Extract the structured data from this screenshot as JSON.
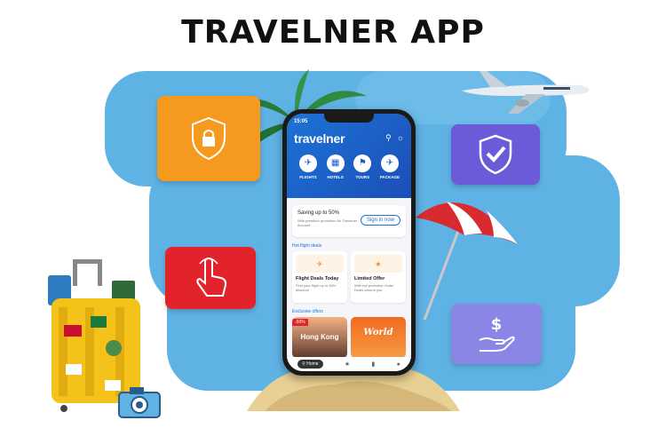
{
  "headline": "TRAVELNER APP",
  "colors": {
    "sky": "#5fb2e4",
    "security_card": "#f59a1e",
    "verified_card": "#6b5bd9",
    "tap_card": "#e3232b",
    "payment_card": "#8a86e6",
    "app_blue": "#1e73d6"
  },
  "feature_cards": [
    {
      "name": "security",
      "icon": "shield-lock-icon"
    },
    {
      "name": "verified",
      "icon": "shield-check-icon"
    },
    {
      "name": "tap",
      "icon": "hand-tap-icon"
    },
    {
      "name": "payment",
      "icon": "hand-dollar-icon"
    }
  ],
  "phone": {
    "time": "15:05",
    "brand": "travelner",
    "header_icons": [
      "search-icon",
      "chat-icon"
    ],
    "nav": [
      {
        "label": "FLIGHTS",
        "icon": "plane-icon"
      },
      {
        "label": "HOTELS",
        "icon": "building-icon"
      },
      {
        "label": "TOURS",
        "icon": "tour-icon"
      },
      {
        "label": "PACKAGE",
        "icon": "plane-package-icon"
      }
    ],
    "promo": {
      "title": "Saving up to 50%",
      "subtitle": "With premium promotion for Travelner Account",
      "button": "Sign in now"
    },
    "hot_deals_title": "Hot flight deals",
    "deals": [
      {
        "title": "Flight Deals Today",
        "subtitle": "Find your flight up to 50% discount"
      },
      {
        "title": "Limited Offer",
        "subtitle": "With hot promotion Hotel Deals around you"
      }
    ],
    "offers_title": "Exclusive offers",
    "offers": [
      {
        "badge": "-50%",
        "text": "Hong Kong"
      },
      {
        "badge": "",
        "text": "World"
      }
    ],
    "bottom_nav": {
      "home": "Home",
      "icons": [
        "star-icon",
        "bookmark-icon",
        "user-icon"
      ]
    }
  }
}
